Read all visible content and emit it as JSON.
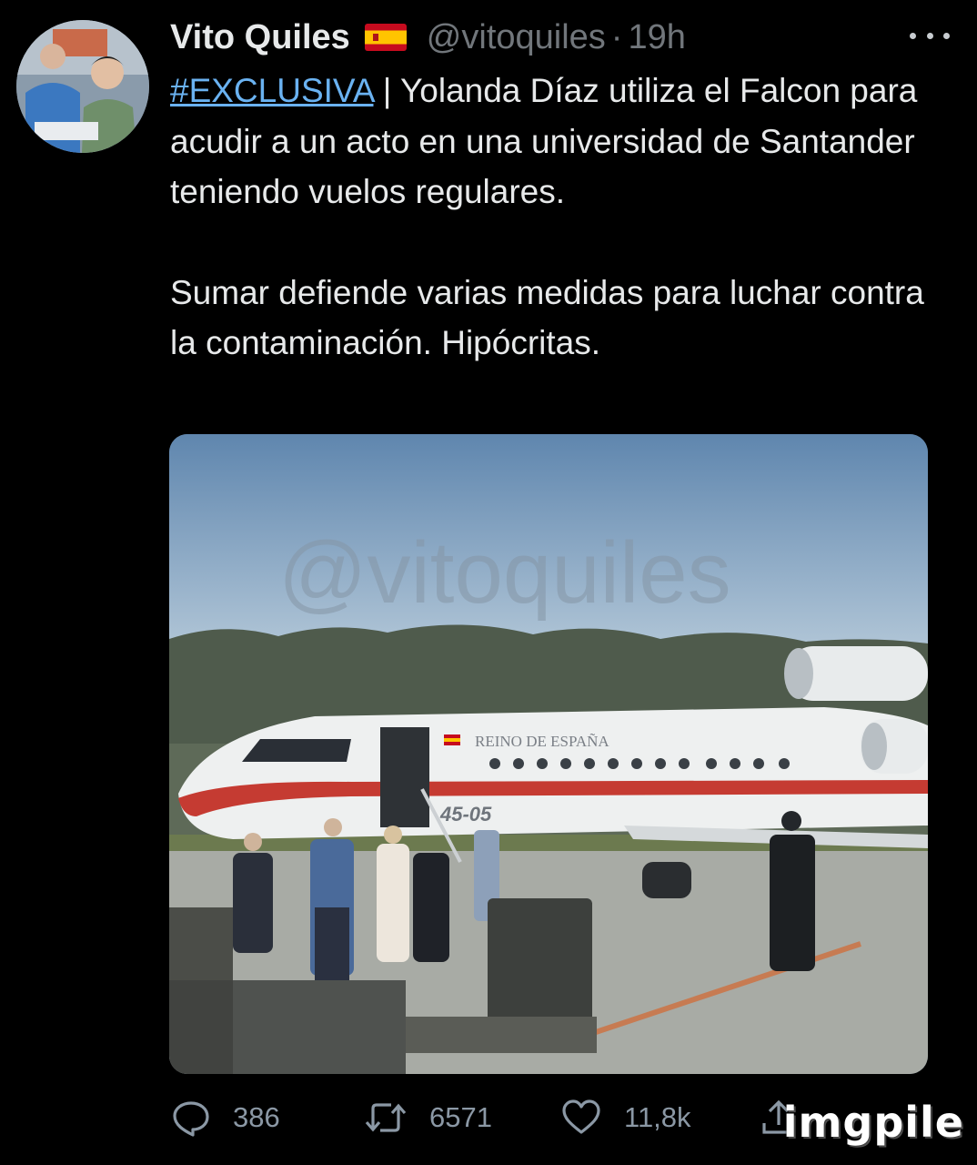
{
  "tweet": {
    "display_name": "Vito Quiles",
    "flag_icon": "spain-flag-icon",
    "handle": "@vitoquiles",
    "separator": "·",
    "time": "19h",
    "hashtag": "#EXCLUSIVA",
    "text_line1_rest": " | Yolanda Díaz utiliza el Falcon para acudir a un acto en una universidad de Santander teniendo vuelos regulares.",
    "text_paragraph2": "Sumar defiende varias medidas para luchar contra la contaminación. Hipócritas."
  },
  "media": {
    "watermark": "@vitoquiles",
    "plane_label": "REINO DE ESPAÑA",
    "plane_number": "45-05"
  },
  "actions": {
    "replies": "386",
    "retweets": "6571",
    "likes": "11,8k"
  },
  "site_watermark": "imgpile",
  "colors": {
    "background": "#000000",
    "text": "#e7e9ea",
    "muted": "#71767b",
    "link": "#6ab2f1"
  }
}
